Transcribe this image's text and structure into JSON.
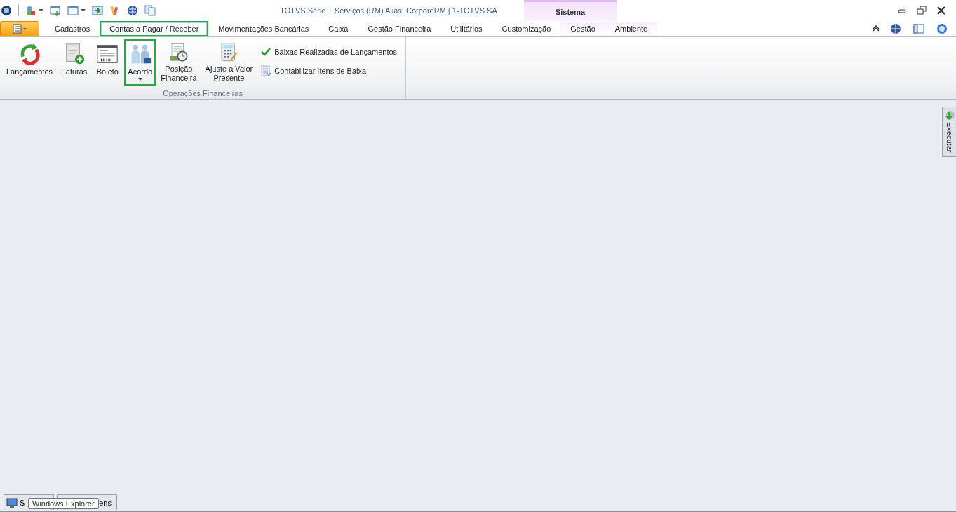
{
  "title_bar": {
    "title": "TOTVS Série T Serviços (RM) Alias: CorporeRM | 1-TOTVS SA",
    "context_group": "Sistema"
  },
  "tabs": [
    {
      "label": "Cadastros",
      "kind": "normal",
      "selected": false,
      "highlighted": false
    },
    {
      "label": "Contas a Pagar / Receber",
      "kind": "normal",
      "selected": true,
      "highlighted": true
    },
    {
      "label": "Movimentações Bancárias",
      "kind": "normal",
      "selected": false,
      "highlighted": false
    },
    {
      "label": "Caixa",
      "kind": "normal",
      "selected": false,
      "highlighted": false
    },
    {
      "label": "Gestão Financeira",
      "kind": "normal",
      "selected": false,
      "highlighted": false
    },
    {
      "label": "Utilitários",
      "kind": "normal",
      "selected": false,
      "highlighted": false
    },
    {
      "label": "Customização",
      "kind": "normal",
      "selected": false,
      "highlighted": false
    },
    {
      "label": "Gestão",
      "kind": "context",
      "selected": false,
      "highlighted": false
    },
    {
      "label": "Ambiente",
      "kind": "context",
      "selected": false,
      "highlighted": false
    }
  ],
  "ribbon_group": {
    "label": "Operações Financeiras",
    "large_buttons": [
      {
        "label": "Lançamentos",
        "highlighted": false,
        "dropdown": false
      },
      {
        "label": "Faturas",
        "highlighted": false,
        "dropdown": false
      },
      {
        "label": "Boleto",
        "highlighted": false,
        "dropdown": false
      },
      {
        "label": "Acordo",
        "highlighted": true,
        "dropdown": true
      },
      {
        "label": "Posição\nFinanceira",
        "highlighted": false,
        "dropdown": false
      },
      {
        "label": "Ajuste a Valor\nPresente",
        "highlighted": false,
        "dropdown": false
      }
    ],
    "small_buttons": [
      {
        "label": "Baixas Realizadas de Lançamentos"
      },
      {
        "label": "Contabilizar Itens de Baixa"
      }
    ]
  },
  "side_panel": {
    "label": "Executar"
  },
  "taskbar": [
    {
      "label": "S"
    },
    {
      "label": "ens"
    }
  ],
  "tooltip": "Windows Explorer"
}
